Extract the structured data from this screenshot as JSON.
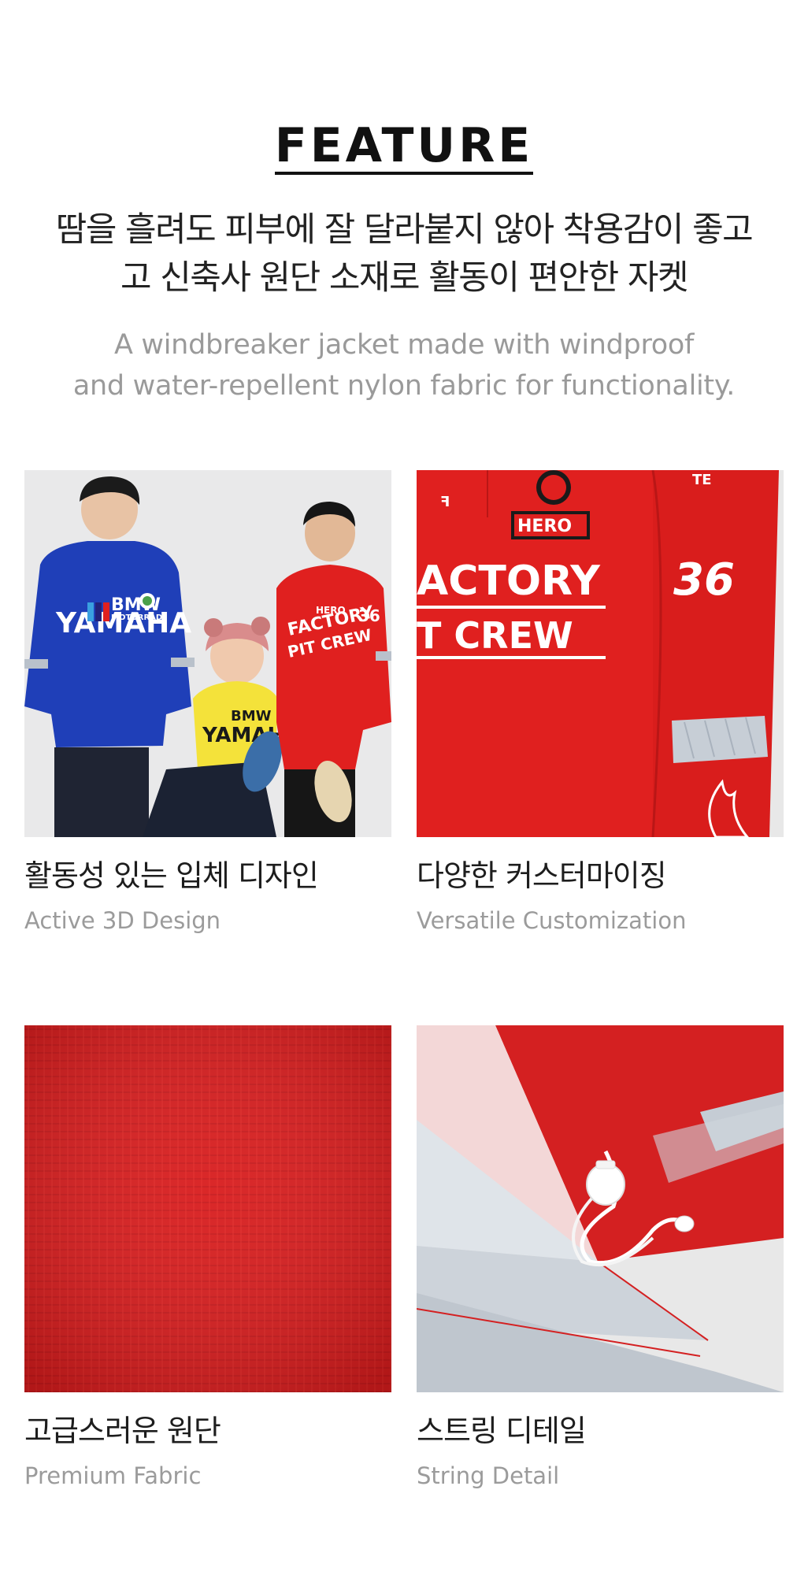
{
  "feature": {
    "title": "FEATURE",
    "headline_ko_line1": "땀을 흘려도 피부에 잘 달라붙지 않아 착용감이 좋고",
    "headline_ko_line2": "고 신축사 원단 소재로 활동이 편안한 자켓",
    "headline_en_line1": "A windbreaker jacket made with windproof",
    "headline_en_line2": "and water-repellent nylon fabric for functionality."
  },
  "cards": [
    {
      "image": "models-wearing-racing-jackets",
      "image_text": [
        "BMW",
        "MOTORRAD",
        "YAMAHA",
        "FACTORY",
        "PIT CREW",
        "HERO"
      ],
      "label_ko": "활동성 있는 입체 디자인",
      "label_en": "Active 3D Design"
    },
    {
      "image": "red-jacket-print-closeup",
      "image_text": [
        "HERO",
        "FACTORY",
        "PIT CREW",
        "36"
      ],
      "label_ko": "다양한 커스터마이징",
      "label_en": "Versatile Customization"
    },
    {
      "image": "red-fabric-texture",
      "label_ko": "고급스러운 원단",
      "label_en": "Premium Fabric"
    },
    {
      "image": "drawstring-toggle-closeup",
      "label_ko": "스트링 디테일",
      "label_en": "String Detail"
    }
  ],
  "colors": {
    "jacket_red": "#e0201f",
    "jacket_blue": "#1f3fb8",
    "jacket_yellow": "#f4e23a",
    "reflective_gray": "#b9c1cb",
    "photo_background": "#e8e8e8",
    "text_dark": "#1d1d1d",
    "text_gray": "#9b9b9b"
  }
}
